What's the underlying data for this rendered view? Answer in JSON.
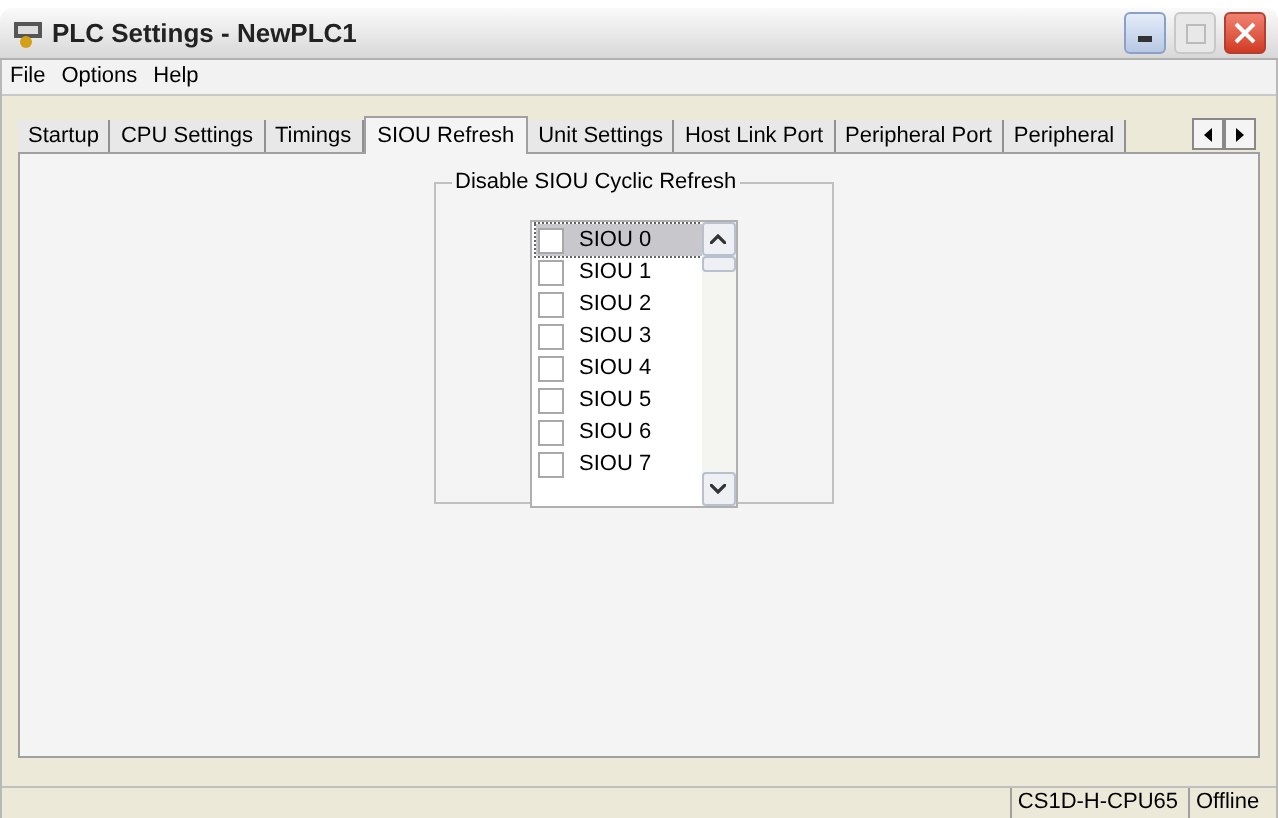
{
  "window": {
    "title": "PLC Settings - NewPLC1"
  },
  "menu": [
    "File",
    "Options",
    "Help"
  ],
  "tabs": [
    {
      "label": "Startup",
      "selected": false
    },
    {
      "label": "CPU Settings",
      "selected": false
    },
    {
      "label": "Timings",
      "selected": false
    },
    {
      "label": "SIOU Refresh",
      "selected": true
    },
    {
      "label": "Unit Settings",
      "selected": false
    },
    {
      "label": "Host Link Port",
      "selected": false
    },
    {
      "label": "Peripheral Port",
      "selected": false
    },
    {
      "label": "Peripheral",
      "selected": false
    }
  ],
  "group": {
    "title": "Disable SIOU Cyclic Refresh",
    "items": [
      {
        "label": "SIOU 0",
        "checked": false,
        "selected": true
      },
      {
        "label": "SIOU 1",
        "checked": false,
        "selected": false
      },
      {
        "label": "SIOU 2",
        "checked": false,
        "selected": false
      },
      {
        "label": "SIOU 3",
        "checked": false,
        "selected": false
      },
      {
        "label": "SIOU 4",
        "checked": false,
        "selected": false
      },
      {
        "label": "SIOU 5",
        "checked": false,
        "selected": false
      },
      {
        "label": "SIOU 6",
        "checked": false,
        "selected": false
      },
      {
        "label": "SIOU 7",
        "checked": false,
        "selected": false
      }
    ]
  },
  "status_bar": [
    "CS1D-H-CPU65",
    "Offline"
  ]
}
